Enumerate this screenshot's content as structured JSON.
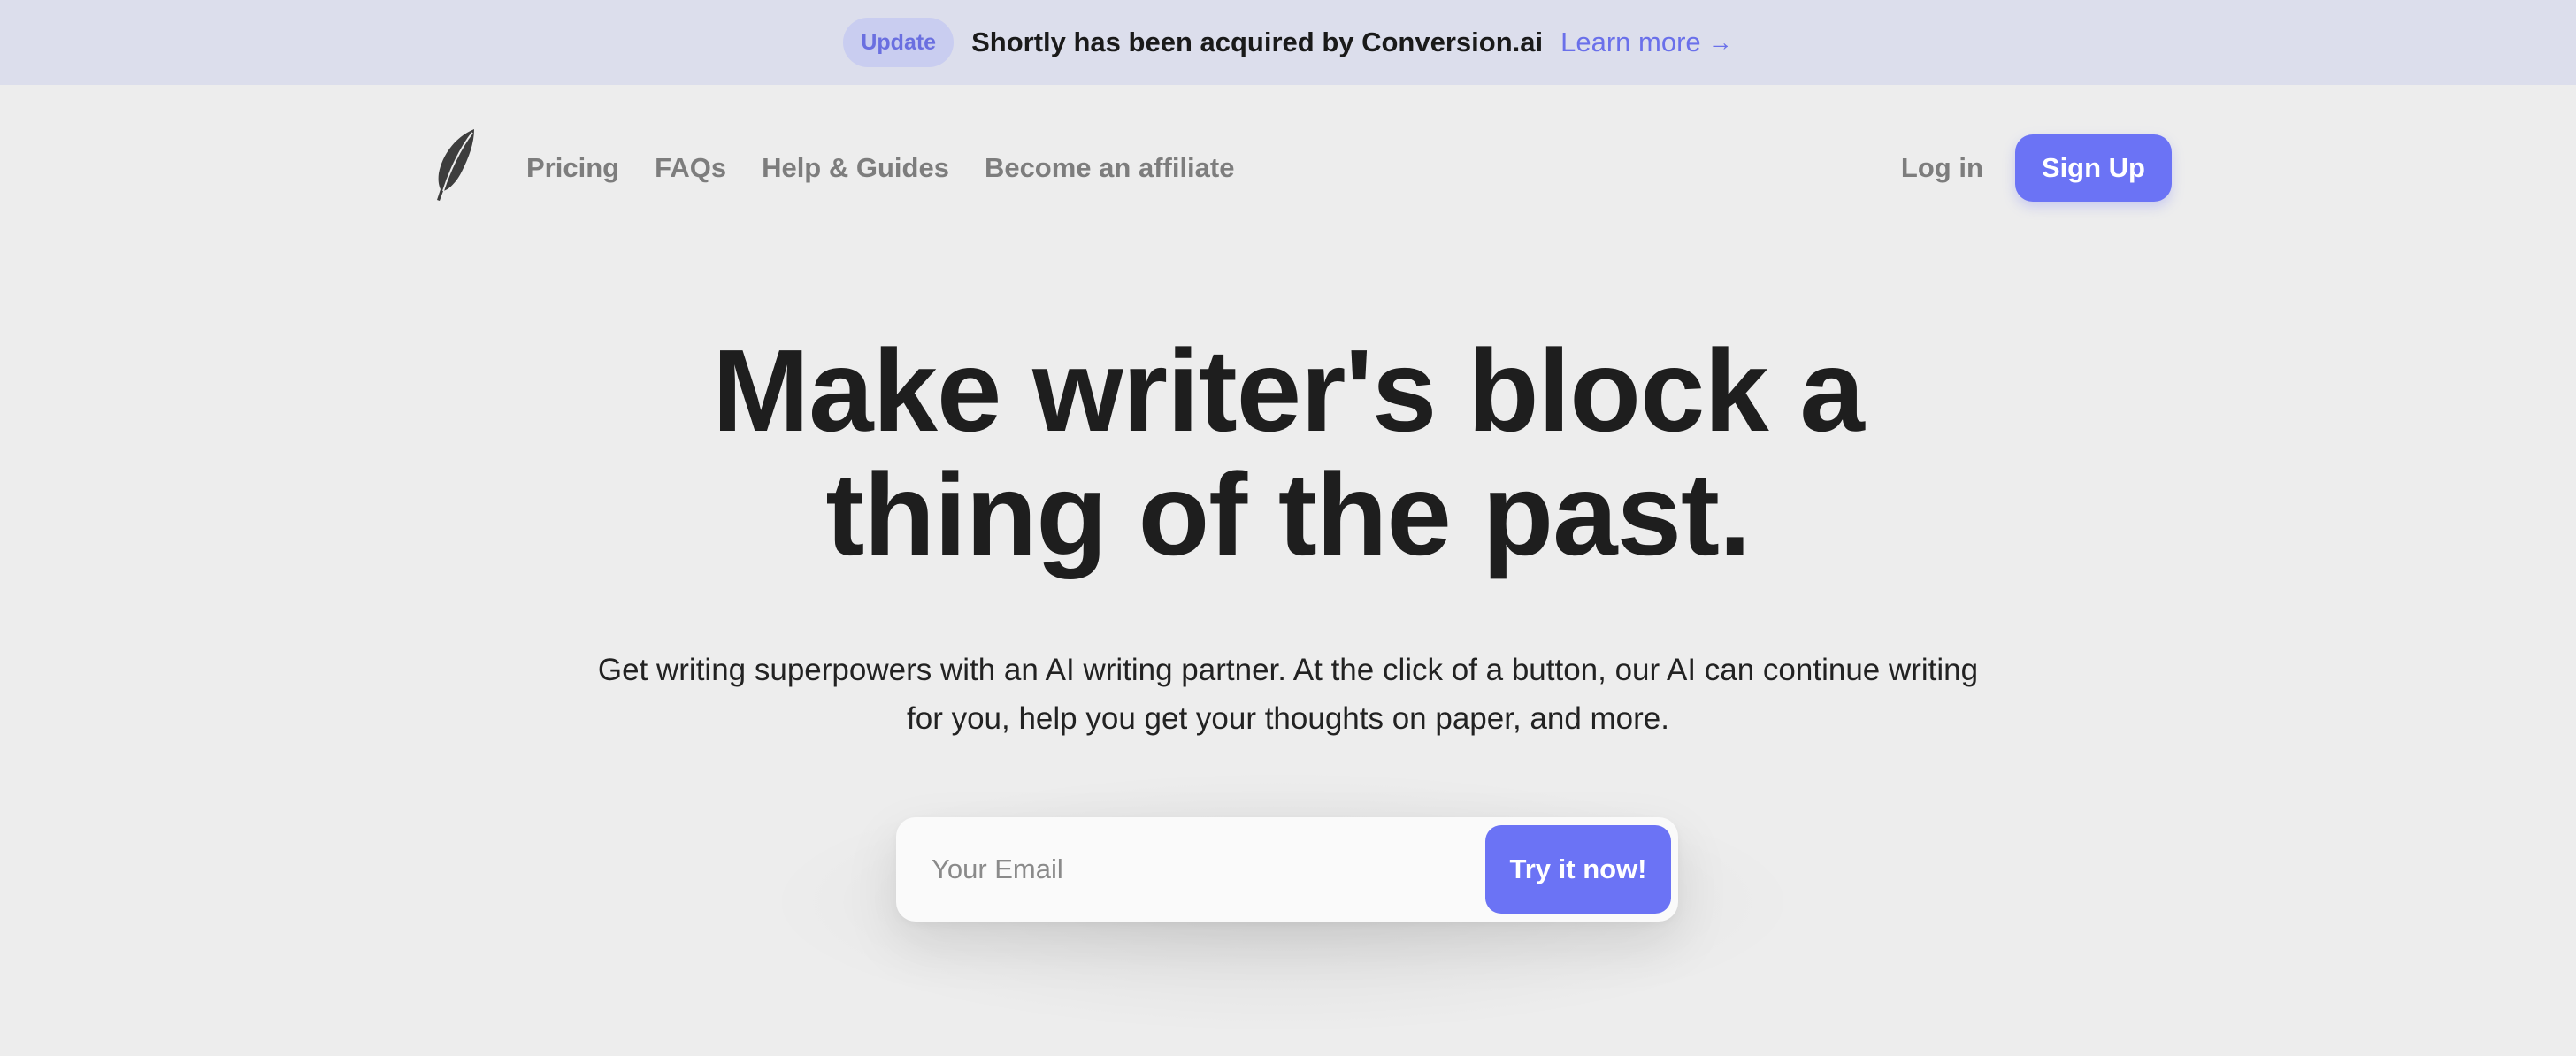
{
  "banner": {
    "badge": "Update",
    "text": "Shortly has been acquired by Conversion.ai",
    "link_label": "Learn more",
    "link_arrow": "→"
  },
  "nav": {
    "logo_icon": "feather-icon",
    "links": [
      {
        "label": "Pricing"
      },
      {
        "label": "FAQs"
      },
      {
        "label": "Help & Guides"
      },
      {
        "label": "Become an affiliate"
      }
    ],
    "login_label": "Log in",
    "signup_label": "Sign Up"
  },
  "hero": {
    "title_line1": "Make writer's block a",
    "title_line2": "thing of the past.",
    "subtitle": "Get writing superpowers with an AI writing partner. At the click of a button, our AI can continue writing for you, help you get your thoughts on paper, and more."
  },
  "signup_form": {
    "email_placeholder": "Your Email",
    "email_value": "",
    "submit_label": "Try it now!"
  },
  "colors": {
    "accent": "#6b73f5",
    "banner_bg": "#dcdeec",
    "page_bg": "#ededed"
  }
}
